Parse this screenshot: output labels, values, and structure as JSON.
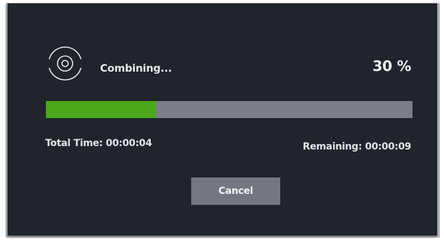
{
  "dialog": {
    "status": {
      "icon": "disc-spinner-icon",
      "label": "Combining..."
    },
    "progress": {
      "percent_text": "30 %",
      "value": 0.3,
      "fill_color": "#4aa81a",
      "track_color": "#7c7f86"
    },
    "total_time": "Total Time: 00:00:04",
    "remaining_time": "Remaining: 00:00:09",
    "cancel_label": "Cancel",
    "background_color": "#20242b"
  }
}
